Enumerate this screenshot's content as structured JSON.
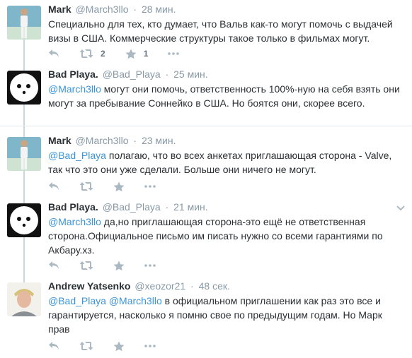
{
  "tweets": [
    {
      "name": "Mark",
      "handle": "@March3llo",
      "time": "28 мин.",
      "avatar": "person-white-suit",
      "parts": [
        {
          "t": "Специально для тех, кто думает, что Вальв как-то могут помочь с выдачей визы в США. Коммерческие структуры такое только в фильмах могут."
        }
      ],
      "retweet_count": "2",
      "favorite_count": "1"
    },
    {
      "name": "Bad Playa.",
      "handle": "@Bad_Playa",
      "time": "25 мин.",
      "avatar": "black-face",
      "parts": [
        {
          "t": "@March3llo",
          "m": true
        },
        {
          "t": " могут они помочь, ответственность 100%-ную на себя взять они могут за пребывание Соннейко в США. Но боятся они, скорее всего."
        }
      ]
    },
    {
      "name": "Mark",
      "handle": "@March3llo",
      "time": "23 мин.",
      "avatar": "person-white-suit",
      "parts": [
        {
          "t": "@Bad_Playa",
          "m": true
        },
        {
          "t": " полагаю, что во всех анкетах приглашающая сторона - Valve, так что это они уже сделали. Больше они ничего не могут."
        }
      ]
    },
    {
      "name": "Bad Playa.",
      "handle": "@Bad_Playa",
      "time": "21 мин.",
      "avatar": "black-face",
      "parts": [
        {
          "t": "@March3llo",
          "m": true
        },
        {
          "t": " да,но приглашающая сторона-это ещё не ответственная сторона.Официальное письмо им писать нужно со всеми гарантиями по Акбару.хз."
        }
      ]
    },
    {
      "name": "Andrew Yatsenko",
      "handle": "@xeozor21",
      "time": "48 сек.",
      "avatar": "person-photo",
      "parts": [
        {
          "t": "@Bad_Playa",
          "m": true
        },
        {
          "t": " "
        },
        {
          "t": "@March3llo",
          "m": true
        },
        {
          "t": " в официальном приглашении как раз это все и гарантируется, насколько я помню свое по предыдущим годам. Но Марк прав"
        }
      ]
    }
  ],
  "colors": {
    "mention": "#3b94d9",
    "meta": "#8899a6",
    "icon": "#aab8c2",
    "thread_line": "#ccd6dd"
  },
  "icons": [
    "reply-icon",
    "retweet-icon",
    "favorite-icon",
    "more-icon",
    "chevron-down-icon"
  ]
}
